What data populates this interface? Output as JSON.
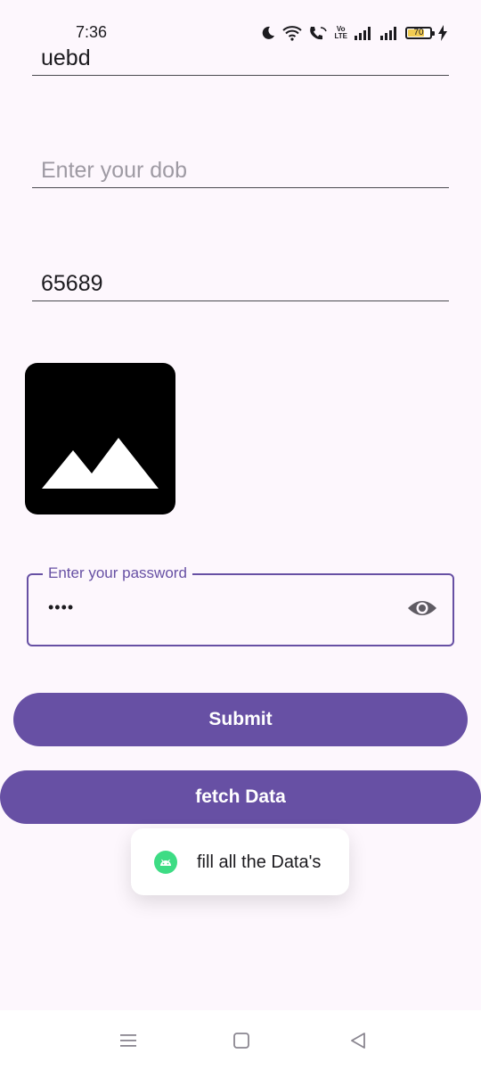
{
  "status_bar": {
    "time": "7:36",
    "battery_percent": "70",
    "volte_label_1": "Vo",
    "volte_label_2": "LTE"
  },
  "fields": {
    "name_value": "uebd",
    "dob_placeholder": "Enter your dob",
    "number_value": "65689"
  },
  "password": {
    "label": "Enter your password",
    "masked_value": "••••"
  },
  "buttons": {
    "submit_label": "Submit",
    "fetch_label": "fetch Data"
  },
  "toast": {
    "message": "fill all the Data's"
  },
  "colors": {
    "primary": "#6750a4",
    "background": "#fdf7fd",
    "toast_icon": "#3ddc84"
  }
}
